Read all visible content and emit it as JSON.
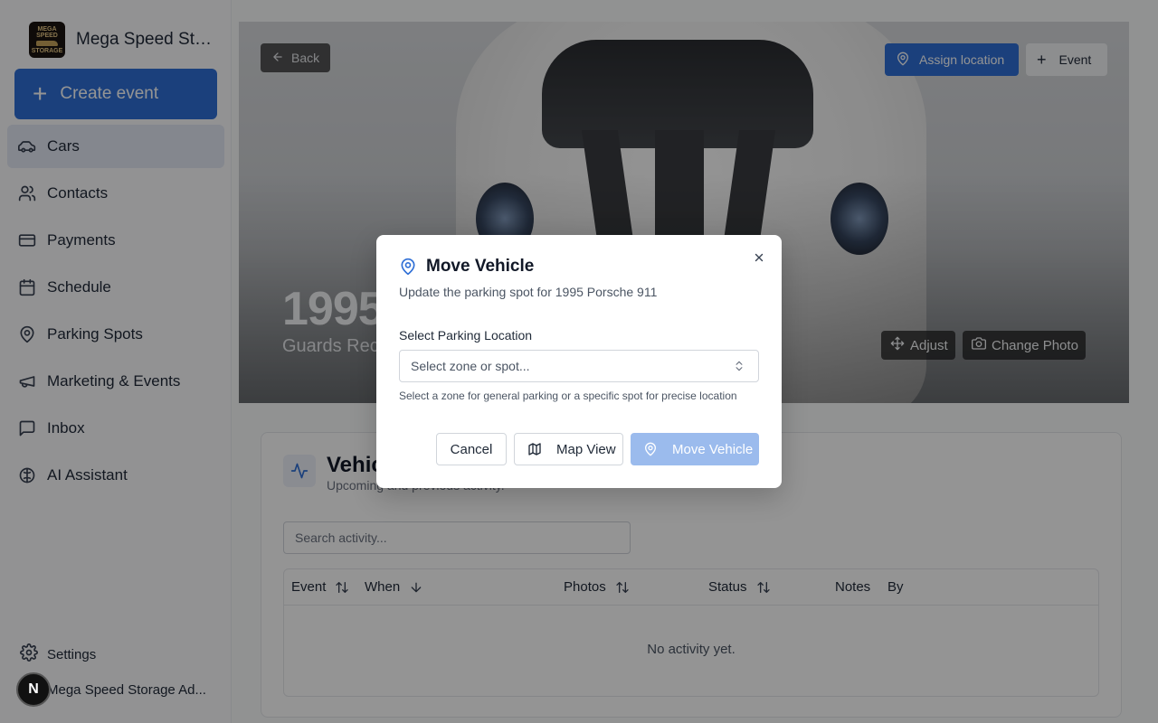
{
  "brand": {
    "name": "Mega Speed Storage",
    "logo_line1": "MEGA SPEED",
    "logo_line2": "STORAGE"
  },
  "sidebar": {
    "create_label": "Create event",
    "items": [
      {
        "label": "Cars",
        "icon": "car-icon",
        "active": true
      },
      {
        "label": "Contacts",
        "icon": "users-icon"
      },
      {
        "label": "Payments",
        "icon": "credit-card-icon"
      },
      {
        "label": "Schedule",
        "icon": "calendar-icon"
      },
      {
        "label": "Parking Spots",
        "icon": "map-pin-icon"
      },
      {
        "label": "Marketing & Events",
        "icon": "megaphone-icon"
      },
      {
        "label": "Inbox",
        "icon": "message-square-icon"
      },
      {
        "label": "AI Assistant",
        "icon": "brain-icon"
      }
    ],
    "settings_label": "Settings",
    "user_initial": "N",
    "user_name": "Mega Speed Storage Ad..."
  },
  "hero": {
    "back_label": "Back",
    "assign_label": "Assign location",
    "event_label": "Event",
    "title": "1995",
    "subtitle": "Guards Rec",
    "adjust_label": "Adjust",
    "change_photo_label": "Change Photo"
  },
  "activity": {
    "title": "Vehic",
    "subtitle": "Upcoming and previous activity.",
    "search_placeholder": "Search activity...",
    "columns": [
      "Event",
      "When",
      "Photos",
      "Status",
      "Notes",
      "By"
    ],
    "empty_text": "No activity yet."
  },
  "modal": {
    "title": "Move Vehicle",
    "description": "Update the parking spot for 1995 Porsche 911",
    "field_label": "Select Parking Location",
    "select_placeholder": "Select zone or spot...",
    "help_text": "Select a zone for general parking or a specific spot for precise location",
    "cancel_label": "Cancel",
    "map_label": "Map View",
    "move_label": "Move Vehicle"
  },
  "colors": {
    "accent": "#2f6fd6",
    "accent_disabled": "#9bbbed",
    "overlay": "rgba(0,0,0,0.42)"
  }
}
